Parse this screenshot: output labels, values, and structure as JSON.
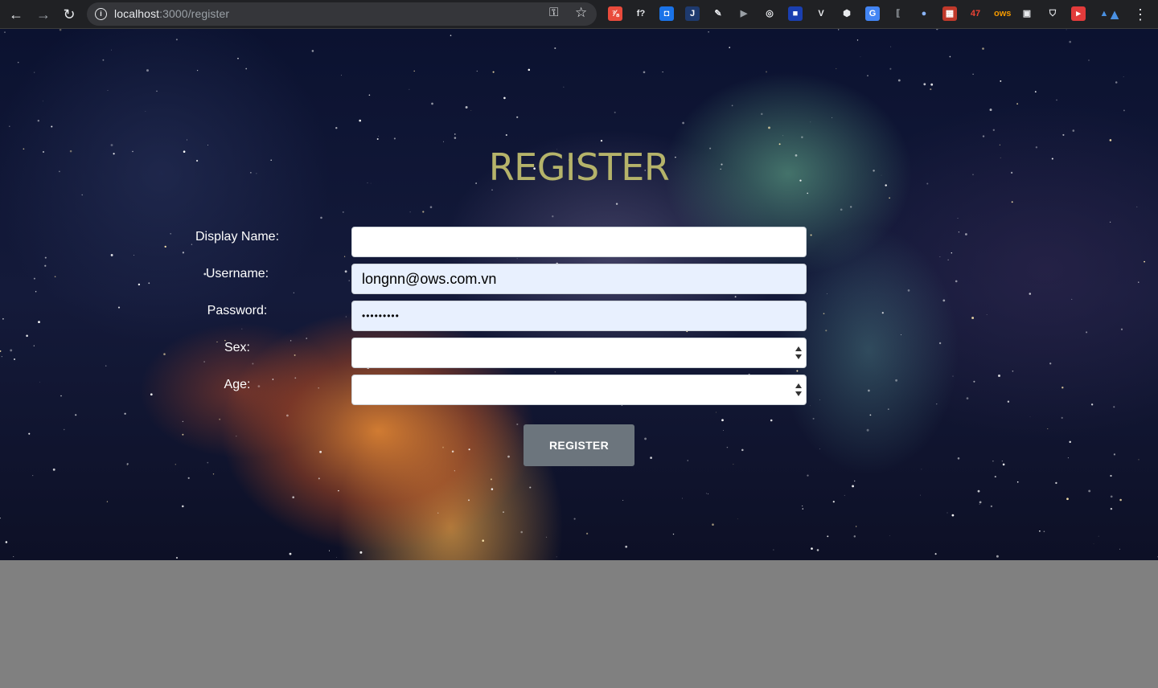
{
  "browser": {
    "url_host": "localhost",
    "url_rest": ":3000/register",
    "extensions": [
      {
        "name": "ext-todo-icon",
        "glyph": "⅞",
        "color": "#e94b3c",
        "text": "#fff"
      },
      {
        "name": "ext-formula-icon",
        "glyph": "f?",
        "color": "transparent",
        "text": "#e8eaed"
      },
      {
        "name": "ext-pocket-icon",
        "glyph": "◘",
        "color": "#1a73e8",
        "text": "#fff"
      },
      {
        "name": "ext-j-icon",
        "glyph": "J",
        "color": "#1e3a6e",
        "text": "#fff"
      },
      {
        "name": "ext-pen-icon",
        "glyph": "✎",
        "color": "transparent",
        "text": "#e8eaed"
      },
      {
        "name": "ext-play-icon",
        "glyph": "▶",
        "color": "transparent",
        "text": "#9aa0a6"
      },
      {
        "name": "ext-target-icon",
        "glyph": "◎",
        "color": "transparent",
        "text": "#e8eaed"
      },
      {
        "name": "ext-square-icon",
        "glyph": "■",
        "color": "#1a3fb0",
        "text": "#fff"
      },
      {
        "name": "ext-vue-icon",
        "glyph": "V",
        "color": "transparent",
        "text": "#e8eaed"
      },
      {
        "name": "ext-cube-icon",
        "glyph": "⬢",
        "color": "transparent",
        "text": "#e8eaed"
      },
      {
        "name": "ext-translate-icon",
        "glyph": "G",
        "color": "#4285f4",
        "text": "#fff"
      },
      {
        "name": "ext-bracket-icon",
        "glyph": "⟦",
        "color": "transparent",
        "text": "#9aa0a6"
      },
      {
        "name": "ext-circle-icon",
        "glyph": "●",
        "color": "transparent",
        "text": "#8ab4f8"
      },
      {
        "name": "ext-grid-icon",
        "glyph": "▦",
        "color": "#c0392b",
        "text": "#fff"
      },
      {
        "name": "ext-badge-icon",
        "glyph": "47",
        "color": "transparent",
        "text": "#ea4335"
      },
      {
        "name": "ext-ows-icon",
        "glyph": "ows",
        "color": "transparent",
        "text": "#f29900"
      },
      {
        "name": "ext-box-icon",
        "glyph": "▣",
        "color": "transparent",
        "text": "#e8eaed"
      },
      {
        "name": "ext-shield-icon",
        "glyph": "⛉",
        "color": "transparent",
        "text": "#e8eaed"
      },
      {
        "name": "ext-save-icon",
        "glyph": "▸",
        "color": "#e23b3b",
        "text": "#fff"
      },
      {
        "name": "ext-triangle-icon",
        "glyph": "▲",
        "color": "transparent",
        "text": "#4a90e2"
      }
    ]
  },
  "page": {
    "title": "REGISTER",
    "labels": {
      "display_name": "Display Name:",
      "username": "Username:",
      "password": "Password:",
      "sex": "Sex:",
      "age": "Age:"
    },
    "values": {
      "display_name": "",
      "username": "longnn@ows.com.vn",
      "password_mask": "•••••••••",
      "sex": "",
      "age": ""
    },
    "register_button": "REGISTER"
  }
}
